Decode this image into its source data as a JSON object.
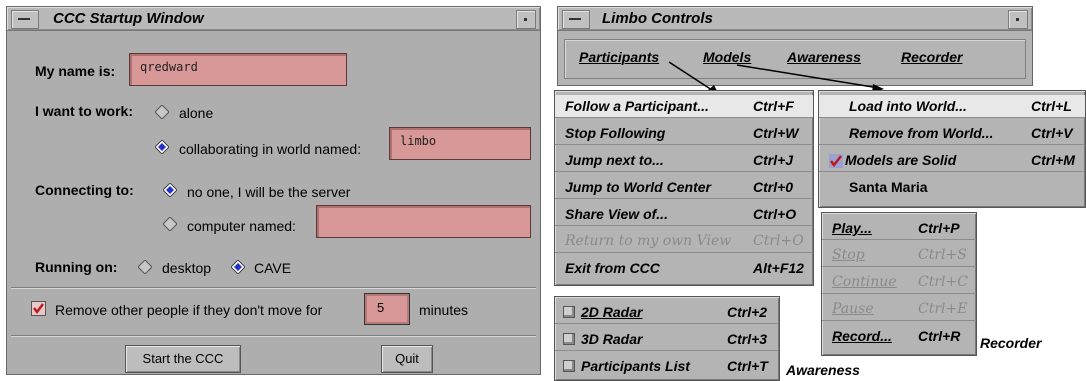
{
  "startup": {
    "title": "CCC Startup Window",
    "name_label": "My name is:",
    "name_value": "qredward",
    "work_label": "I want to work:",
    "alone_label": "alone",
    "collab_label": "collaborating in world named:",
    "world_value": "limbo",
    "connecting_label": "Connecting to:",
    "server_label": "no one, I will be the server",
    "computer_label": "computer named:",
    "computer_value": "",
    "running_label": "Running on:",
    "desktop_label": "desktop",
    "cave_label": "CAVE",
    "remove_label": "Remove other people if they don't move for",
    "minutes_value": "5",
    "minutes_label": "minutes",
    "start_button": "Start the CCC",
    "quit_button": "Quit",
    "selected": {
      "work": "collaborating",
      "connecting": "server",
      "running": "CAVE"
    },
    "remove_checked": true
  },
  "limbo": {
    "title": "Limbo Controls",
    "menubar": [
      "Participants",
      "Models",
      "Awareness",
      "Recorder"
    ]
  },
  "participants_menu": [
    {
      "label": "Follow a Participant...",
      "accel": "Ctrl+F",
      "enabled": true,
      "highlighted": true
    },
    {
      "label": "Stop Following",
      "accel": "Ctrl+W",
      "enabled": true
    },
    {
      "label": "Jump next to...",
      "accel": "Ctrl+J",
      "enabled": true
    },
    {
      "label": "Jump to World Center",
      "accel": "Ctrl+0",
      "enabled": true
    },
    {
      "label": "Share View of...",
      "accel": "Ctrl+O",
      "enabled": true
    },
    {
      "label": "Return to my own View",
      "accel": "Ctrl+O",
      "enabled": false
    },
    {
      "label": "Exit from CCC",
      "accel": "Alt+F12",
      "enabled": true
    }
  ],
  "models_menu": [
    {
      "label": "Load into World...",
      "accel": "Ctrl+L",
      "enabled": true,
      "highlighted": true
    },
    {
      "label": "Remove from World...",
      "accel": "Ctrl+V",
      "enabled": true
    },
    {
      "label": "Models are Solid",
      "accel": "Ctrl+M",
      "enabled": true,
      "checked": true
    },
    {
      "label": "Santa Maria",
      "accel": "",
      "enabled": true
    }
  ],
  "recorder_menu": [
    {
      "label": "Play...",
      "accel": "Ctrl+P",
      "enabled": true
    },
    {
      "label": "Stop",
      "accel": "Ctrl+S",
      "enabled": false
    },
    {
      "label": "Continue",
      "accel": "Ctrl+C",
      "enabled": false
    },
    {
      "label": "Pause",
      "accel": "Ctrl+E",
      "enabled": false
    },
    {
      "label": "Record...",
      "accel": "Ctrl+R",
      "enabled": true
    }
  ],
  "recorder_caption": "Recorder",
  "awareness_menu": [
    {
      "label": "2D Radar",
      "accel": "Ctrl+2",
      "enabled": true
    },
    {
      "label": "3D Radar",
      "accel": "Ctrl+3",
      "enabled": true
    },
    {
      "label": "Participants List",
      "accel": "Ctrl+T",
      "enabled": true
    }
  ],
  "awareness_caption": "Awareness",
  "colors": {
    "field": "#d89898",
    "radio_selected": "#2233cc",
    "window_bg": "#aeaeae",
    "menu_bg": "#b4b4b4"
  }
}
